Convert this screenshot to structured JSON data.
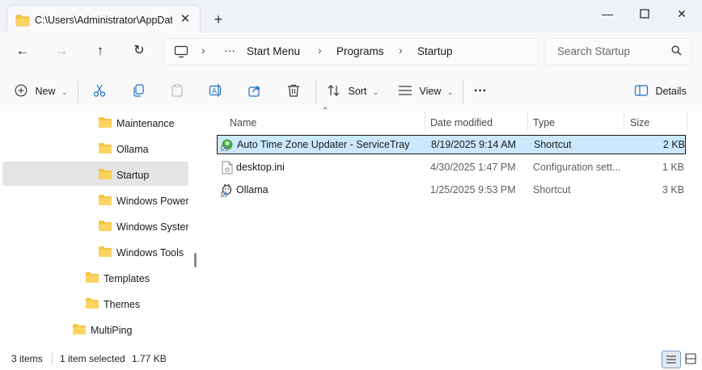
{
  "window": {
    "tab_title": "C:\\Users\\Administrator\\AppData\\Roaming\\Microsoft\\Windows\\Start Menu\\Programs\\Startup"
  },
  "address": {
    "breadcrumbs": [
      "Start Menu",
      "Programs",
      "Startup"
    ],
    "overflow": "···"
  },
  "search": {
    "placeholder": "Search Startup"
  },
  "toolbar": {
    "new_label": "New",
    "sort_label": "Sort",
    "view_label": "View",
    "more_label": "···",
    "details_label": "Details"
  },
  "nav": {
    "items": [
      {
        "label": "Maintenance"
      },
      {
        "label": "Ollama"
      },
      {
        "label": "Startup",
        "selected": true
      },
      {
        "label": "Windows PowerShell"
      },
      {
        "label": "Windows System"
      },
      {
        "label": "Windows Tools"
      },
      {
        "label": "Templates"
      },
      {
        "label": "Themes"
      },
      {
        "label": "MultiPing"
      }
    ]
  },
  "table": {
    "columns": [
      "Name",
      "Date modified",
      "Type",
      "Size"
    ],
    "rows": [
      {
        "name": "Auto Time Zone Updater - ServiceTray",
        "date": "8/19/2025 9:14 AM",
        "type": "Shortcut",
        "size": "2 KB",
        "icon": "shortcut-green-icon",
        "selected": true
      },
      {
        "name": "desktop.ini",
        "date": "4/30/2025 1:47 PM",
        "type": "Configuration sett...",
        "size": "1 KB",
        "icon": "ini-file-icon",
        "selected": false
      },
      {
        "name": "Ollama",
        "date": "1/25/2025 9:53 PM",
        "type": "Shortcut",
        "size": "3 KB",
        "icon": "ollama-icon",
        "selected": false
      }
    ]
  },
  "status": {
    "items_count": "3 items",
    "selection": "1 item selected",
    "selection_size": "1.77 KB"
  },
  "colors": {
    "folder": "#f5c542",
    "selection": "#cce8ff",
    "titlebar": "#eef1f6"
  }
}
